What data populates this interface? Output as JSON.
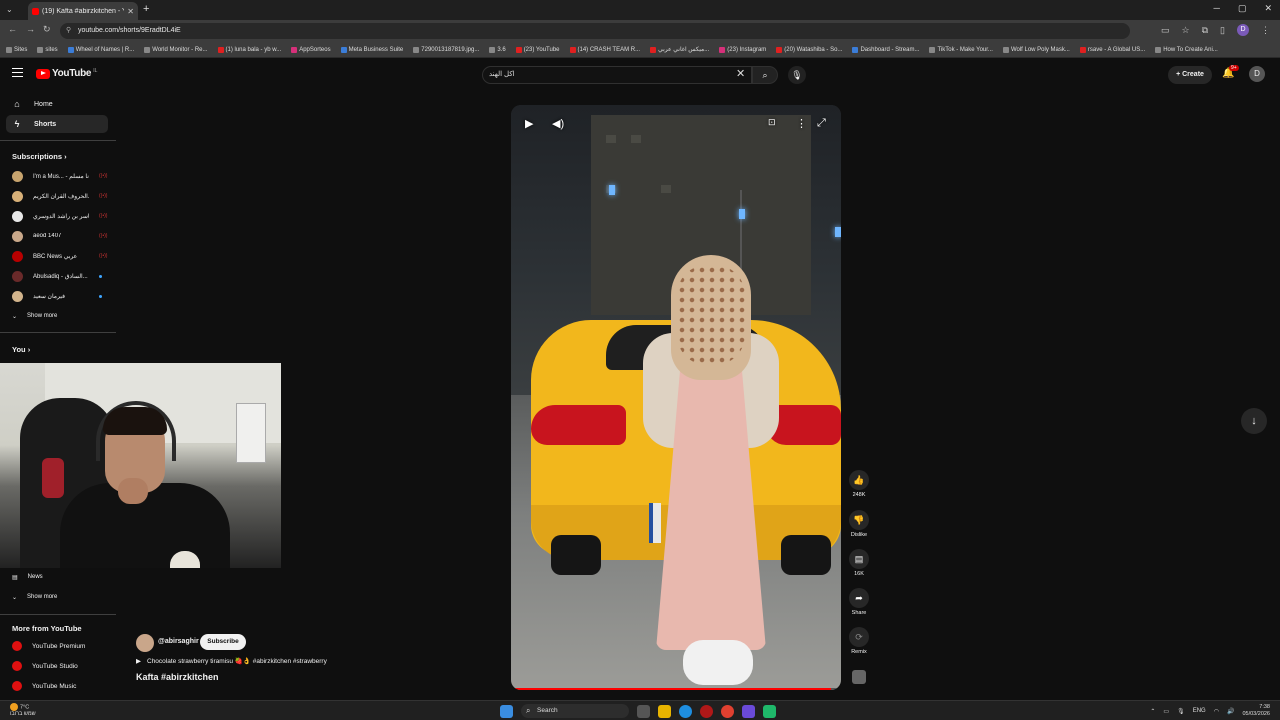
{
  "browser": {
    "tab_title": "(19) Kafta #abirzkitchen - Yo",
    "url": "youtube.com/shorts/9EradtDL4iE",
    "bookmarks": [
      {
        "label": "Sites",
        "color": "gray"
      },
      {
        "label": "sites",
        "color": "gray"
      },
      {
        "label": "Wheel of Names | R...",
        "color": "blue"
      },
      {
        "label": "World Monitor - Re...",
        "color": "gray"
      },
      {
        "label": "(1) luna bala - yb w...",
        "color": "red"
      },
      {
        "label": "AppSorteos",
        "color": "pink"
      },
      {
        "label": "Meta Business Suite",
        "color": "blue"
      },
      {
        "label": "7290013187819.jpg...",
        "color": "gray"
      },
      {
        "label": "3.6",
        "color": "gray"
      },
      {
        "label": "(23) YouTube",
        "color": "red"
      },
      {
        "label": "(14) CRASH TEAM R...",
        "color": "red"
      },
      {
        "label": "ميكس اغاني عربي...",
        "color": "red"
      },
      {
        "label": "(23) Instagram",
        "color": "pink"
      },
      {
        "label": "(20) Watashiba - So...",
        "color": "red"
      },
      {
        "label": "Dashboard - Stream...",
        "color": "blue"
      },
      {
        "label": "TikTok - Make Your...",
        "color": "gray"
      },
      {
        "label": "Wolf Low Poly Mask...",
        "color": "gray"
      },
      {
        "label": "rsave - A Global US...",
        "color": "red"
      },
      {
        "label": "How To Create Ani...",
        "color": "gray"
      }
    ]
  },
  "header": {
    "logo_text": "YouTube",
    "logo_region": "IL",
    "search_value": "اكل الهند",
    "create_label": "Create",
    "notification_badge": "9+",
    "avatar_letter": "D"
  },
  "sidebar": {
    "home_label": "Home",
    "shorts_label": "Shorts",
    "subscriptions_label": "Subscriptions",
    "subscriptions": [
      {
        "name": "I'm a Mus... - انا مسلم",
        "color": "#c8a46e",
        "indicator": "live"
      },
      {
        "name": "الحروف القرآن الكريم...",
        "color": "#d8b078",
        "indicator": "live"
      },
      {
        "name": "ياسر بن راشد الدوسري",
        "color": "#e8e8e8",
        "indicator": "live"
      },
      {
        "name": "aeod 1407",
        "color": "#c9a88a",
        "indicator": "live"
      },
      {
        "name": "BBC News عربي",
        "color": "#b80000",
        "indicator": "live"
      },
      {
        "name": "Abulsadiq - السادق...",
        "color": "#6a2a2a",
        "indicator": "dot"
      },
      {
        "name": "فيرمان سعيد",
        "color": "#d2b48c",
        "indicator": "dot"
      }
    ],
    "show_more_label": "Show more",
    "you_label": "You",
    "news_label": "News",
    "show_more_label_2": "Show more",
    "more_from_label": "More from YouTube",
    "more_from": [
      {
        "label": "YouTube Premium"
      },
      {
        "label": "YouTube Studio"
      },
      {
        "label": "YouTube Music"
      }
    ]
  },
  "short": {
    "channel_handle": "@abirsaghir",
    "subscribe_label": "Subscribe",
    "music_text": "Chocolate strawberry tiramisu 🍓👌 #abirzkitchen #strawberry",
    "title": "Kafta #abirzkitchen",
    "progress": 0.97
  },
  "actions": {
    "like_count": "248K",
    "dislike_label": "Dislike",
    "comment_count": "16K",
    "share_label": "Share",
    "remix_label": "Remix"
  },
  "taskbar": {
    "weather_temp": "7°C",
    "weather_text": "שמש ברובו",
    "search_label": "Search",
    "lang": "ENG",
    "time": "7:38",
    "date": "05/03/2026"
  }
}
